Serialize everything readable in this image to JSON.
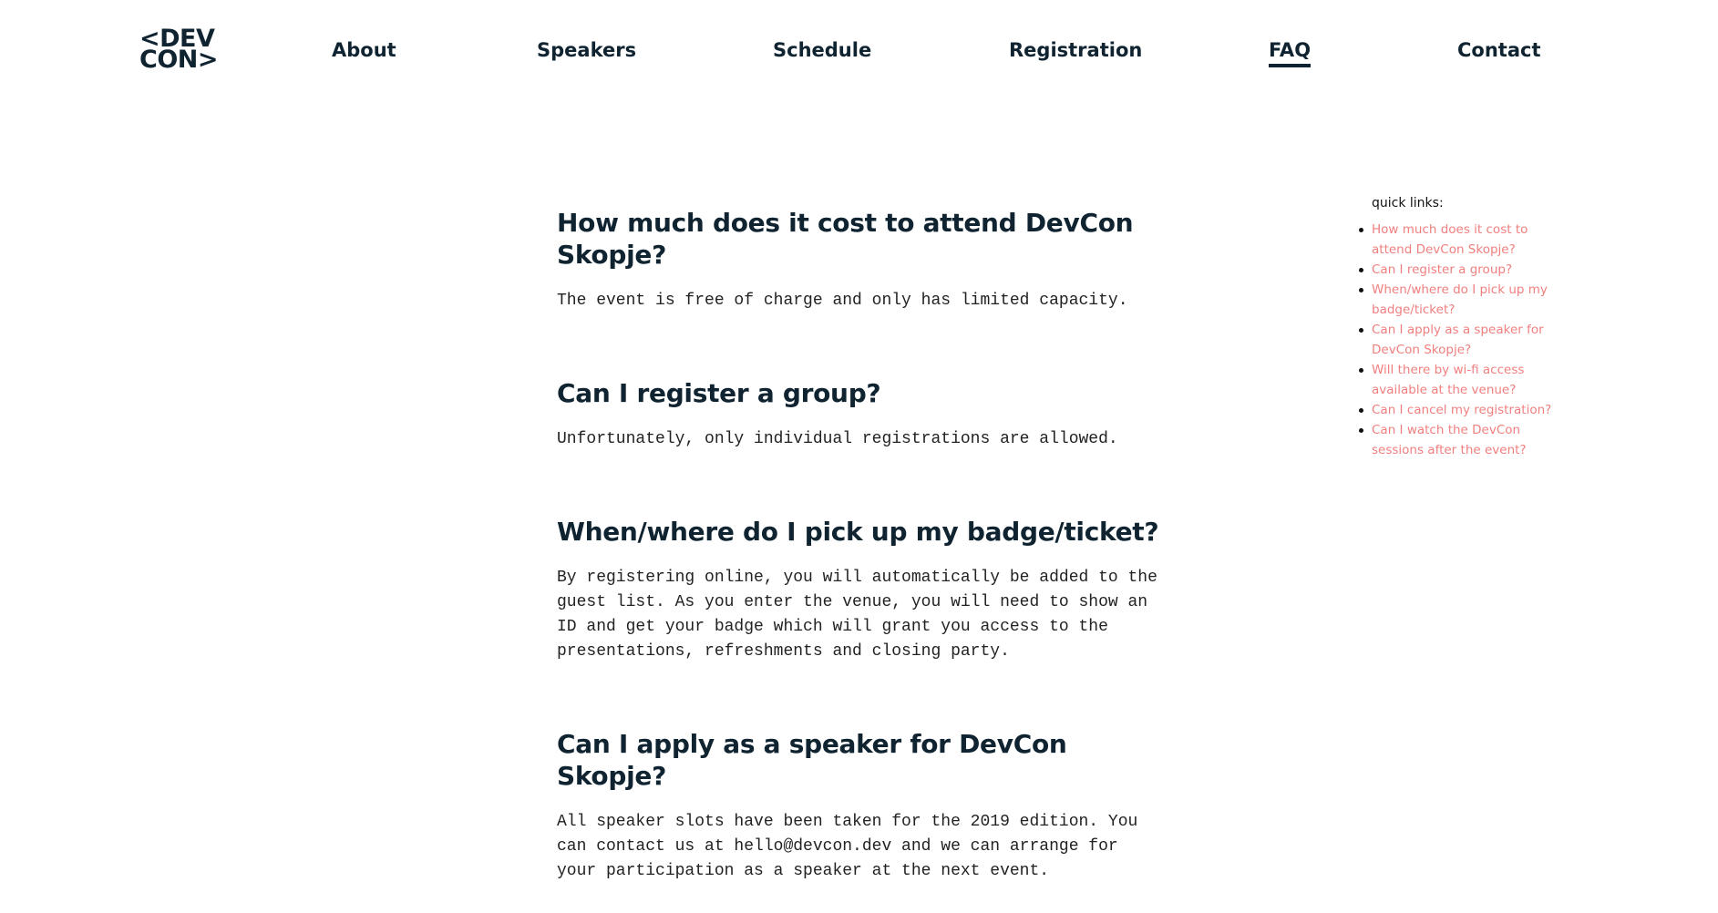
{
  "header": {
    "logo_line1": "<DEV",
    "logo_line2": "CON>",
    "nav": [
      {
        "label": "About"
      },
      {
        "label": "Speakers"
      },
      {
        "label": "Schedule"
      },
      {
        "label": "Registration"
      },
      {
        "label": "FAQ",
        "active": true
      },
      {
        "label": "Contact"
      }
    ]
  },
  "faq": [
    {
      "question": "How much does it cost to attend DevCon Skopje?",
      "answer": "The event is free of charge and only has limited capacity."
    },
    {
      "question": "Can I register a group?",
      "answer": "Unfortunately, only individual registrations are allowed."
    },
    {
      "question": "When/where do I pick up my badge/ticket?",
      "answer": "By registering online, you will automatically be added to the guest list. As you enter the venue, you will need to show an ID and get your badge which will grant you access to the presentations, refreshments and closing party."
    },
    {
      "question": "Can I apply as a speaker for DevCon Skopje?",
      "answer": "All speaker slots have been taken for the 2019 edition. You can contact us at hello@devcon.dev and we can arrange for your participation as a speaker at the next event."
    }
  ],
  "sidebar": {
    "title": "quick links:",
    "links": [
      {
        "label": "How much does it cost to attend DevCon Skopje?"
      },
      {
        "label": "Can I register a group?"
      },
      {
        "label": "When/where do I pick up my badge/ticket?"
      },
      {
        "label": "Can I apply as a speaker for DevCon Skopje?"
      },
      {
        "label": "Will there by wi-fi access available at the venue?"
      },
      {
        "label": "Can I cancel my registration?"
      },
      {
        "label": "Can I watch the DevCon sessions after the event?"
      }
    ]
  },
  "colors": {
    "text_dark": "#0f2330",
    "link_accent": "#f07f7f",
    "background": "#ffffff"
  }
}
